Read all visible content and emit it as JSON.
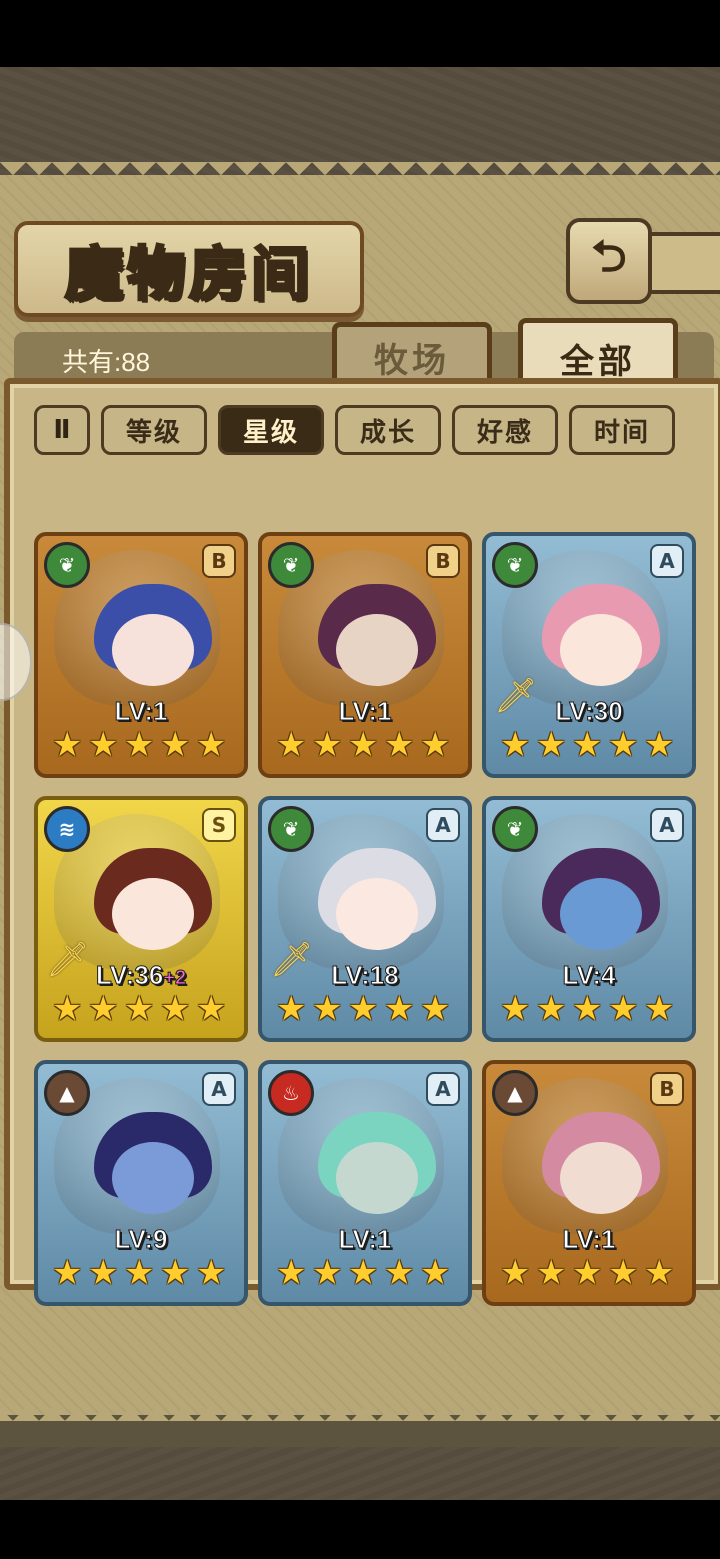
{
  "header": {
    "title": "魔物房间",
    "back_icon": "return-arrow-icon"
  },
  "summary": {
    "count_label": "共有:88"
  },
  "tabs": [
    {
      "label": "牧场",
      "active": false
    },
    {
      "label": "全部",
      "active": true
    }
  ],
  "sort": {
    "toggle_label": "Ⅱ",
    "options": [
      {
        "label": "等级",
        "active": false
      },
      {
        "label": "星级",
        "active": true
      },
      {
        "label": "成长",
        "active": false
      },
      {
        "label": "好感",
        "active": false
      },
      {
        "label": "时间",
        "active": false
      }
    ]
  },
  "monsters": [
    {
      "element": "nature",
      "rank": "B",
      "frame": "gold",
      "level": "LV:1",
      "plus": "",
      "weapon": false,
      "stars": 5,
      "hair": "#3b4fa8",
      "skin": "#f6e2da"
    },
    {
      "element": "nature",
      "rank": "B",
      "frame": "gold",
      "level": "LV:1",
      "plus": "",
      "weapon": false,
      "stars": 5,
      "hair": "#5a2a4a",
      "skin": "#e8d4c4"
    },
    {
      "element": "nature",
      "rank": "A",
      "frame": "silver",
      "level": "LV:30",
      "plus": "",
      "weapon": true,
      "stars": 5,
      "hair": "#e89ab0",
      "skin": "#fbe6dc"
    },
    {
      "element": "water",
      "rank": "S",
      "frame": "yellow",
      "level": "LV:36",
      "plus": "+2",
      "weapon": true,
      "stars": 5,
      "hair": "#6a2a1e",
      "skin": "#fbe6dc"
    },
    {
      "element": "nature",
      "rank": "A",
      "frame": "silver",
      "level": "LV:18",
      "plus": "",
      "weapon": true,
      "stars": 5,
      "hair": "#dcdce4",
      "skin": "#fbe8e0"
    },
    {
      "element": "nature",
      "rank": "A",
      "frame": "silver",
      "level": "LV:4",
      "plus": "",
      "weapon": false,
      "stars": 5,
      "hair": "#4a2a5a",
      "skin": "#6a9ad4"
    },
    {
      "element": "earth",
      "rank": "A",
      "frame": "silver",
      "level": "LV:9",
      "plus": "",
      "weapon": false,
      "stars": 5,
      "hair": "#2a2a6a",
      "skin": "#7a9ad8"
    },
    {
      "element": "fire",
      "rank": "A",
      "frame": "silver",
      "level": "LV:1",
      "plus": "",
      "weapon": false,
      "stars": 5,
      "hair": "#7ad4c0",
      "skin": "#c4d8d0"
    },
    {
      "element": "earth",
      "rank": "B",
      "frame": "gold",
      "level": "LV:1",
      "plus": "",
      "weapon": false,
      "stars": 5,
      "hair": "#d48aa0",
      "skin": "#f0dcd0"
    }
  ],
  "element_glyphs": {
    "nature": "❦",
    "water": "≋",
    "earth": "▲",
    "fire": "♨"
  },
  "star_glyph": "★",
  "weapon_glyph": "🗡"
}
